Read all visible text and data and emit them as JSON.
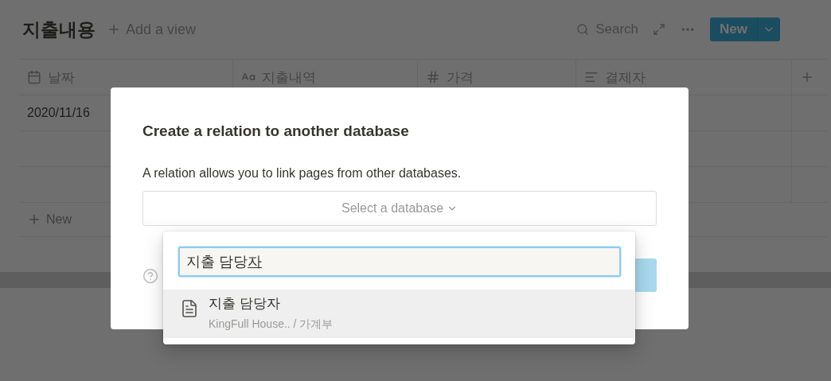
{
  "page": {
    "title": "지출내용",
    "add_view": "Add a view",
    "search": "Search",
    "new_button": "New"
  },
  "table": {
    "columns": [
      {
        "label": "날짜",
        "kind": "date"
      },
      {
        "label": "지출내역",
        "kind": "title"
      },
      {
        "label": "가격",
        "kind": "number"
      },
      {
        "label": "결제자",
        "kind": "text"
      }
    ],
    "rows": [
      {
        "date": "2020/11/16"
      }
    ],
    "new_row": "New"
  },
  "dialog": {
    "title": "Create a relation to another database",
    "description": "A relation allows you to link pages from other databases.",
    "select": {
      "placeholder": "Select a database"
    }
  },
  "dropdown": {
    "search": {
      "value": "지출 담당",
      "composing": "자"
    },
    "results": [
      {
        "title": "지출 담당자",
        "path": "KingFull House.. / 가계부",
        "selected": true
      }
    ]
  }
}
